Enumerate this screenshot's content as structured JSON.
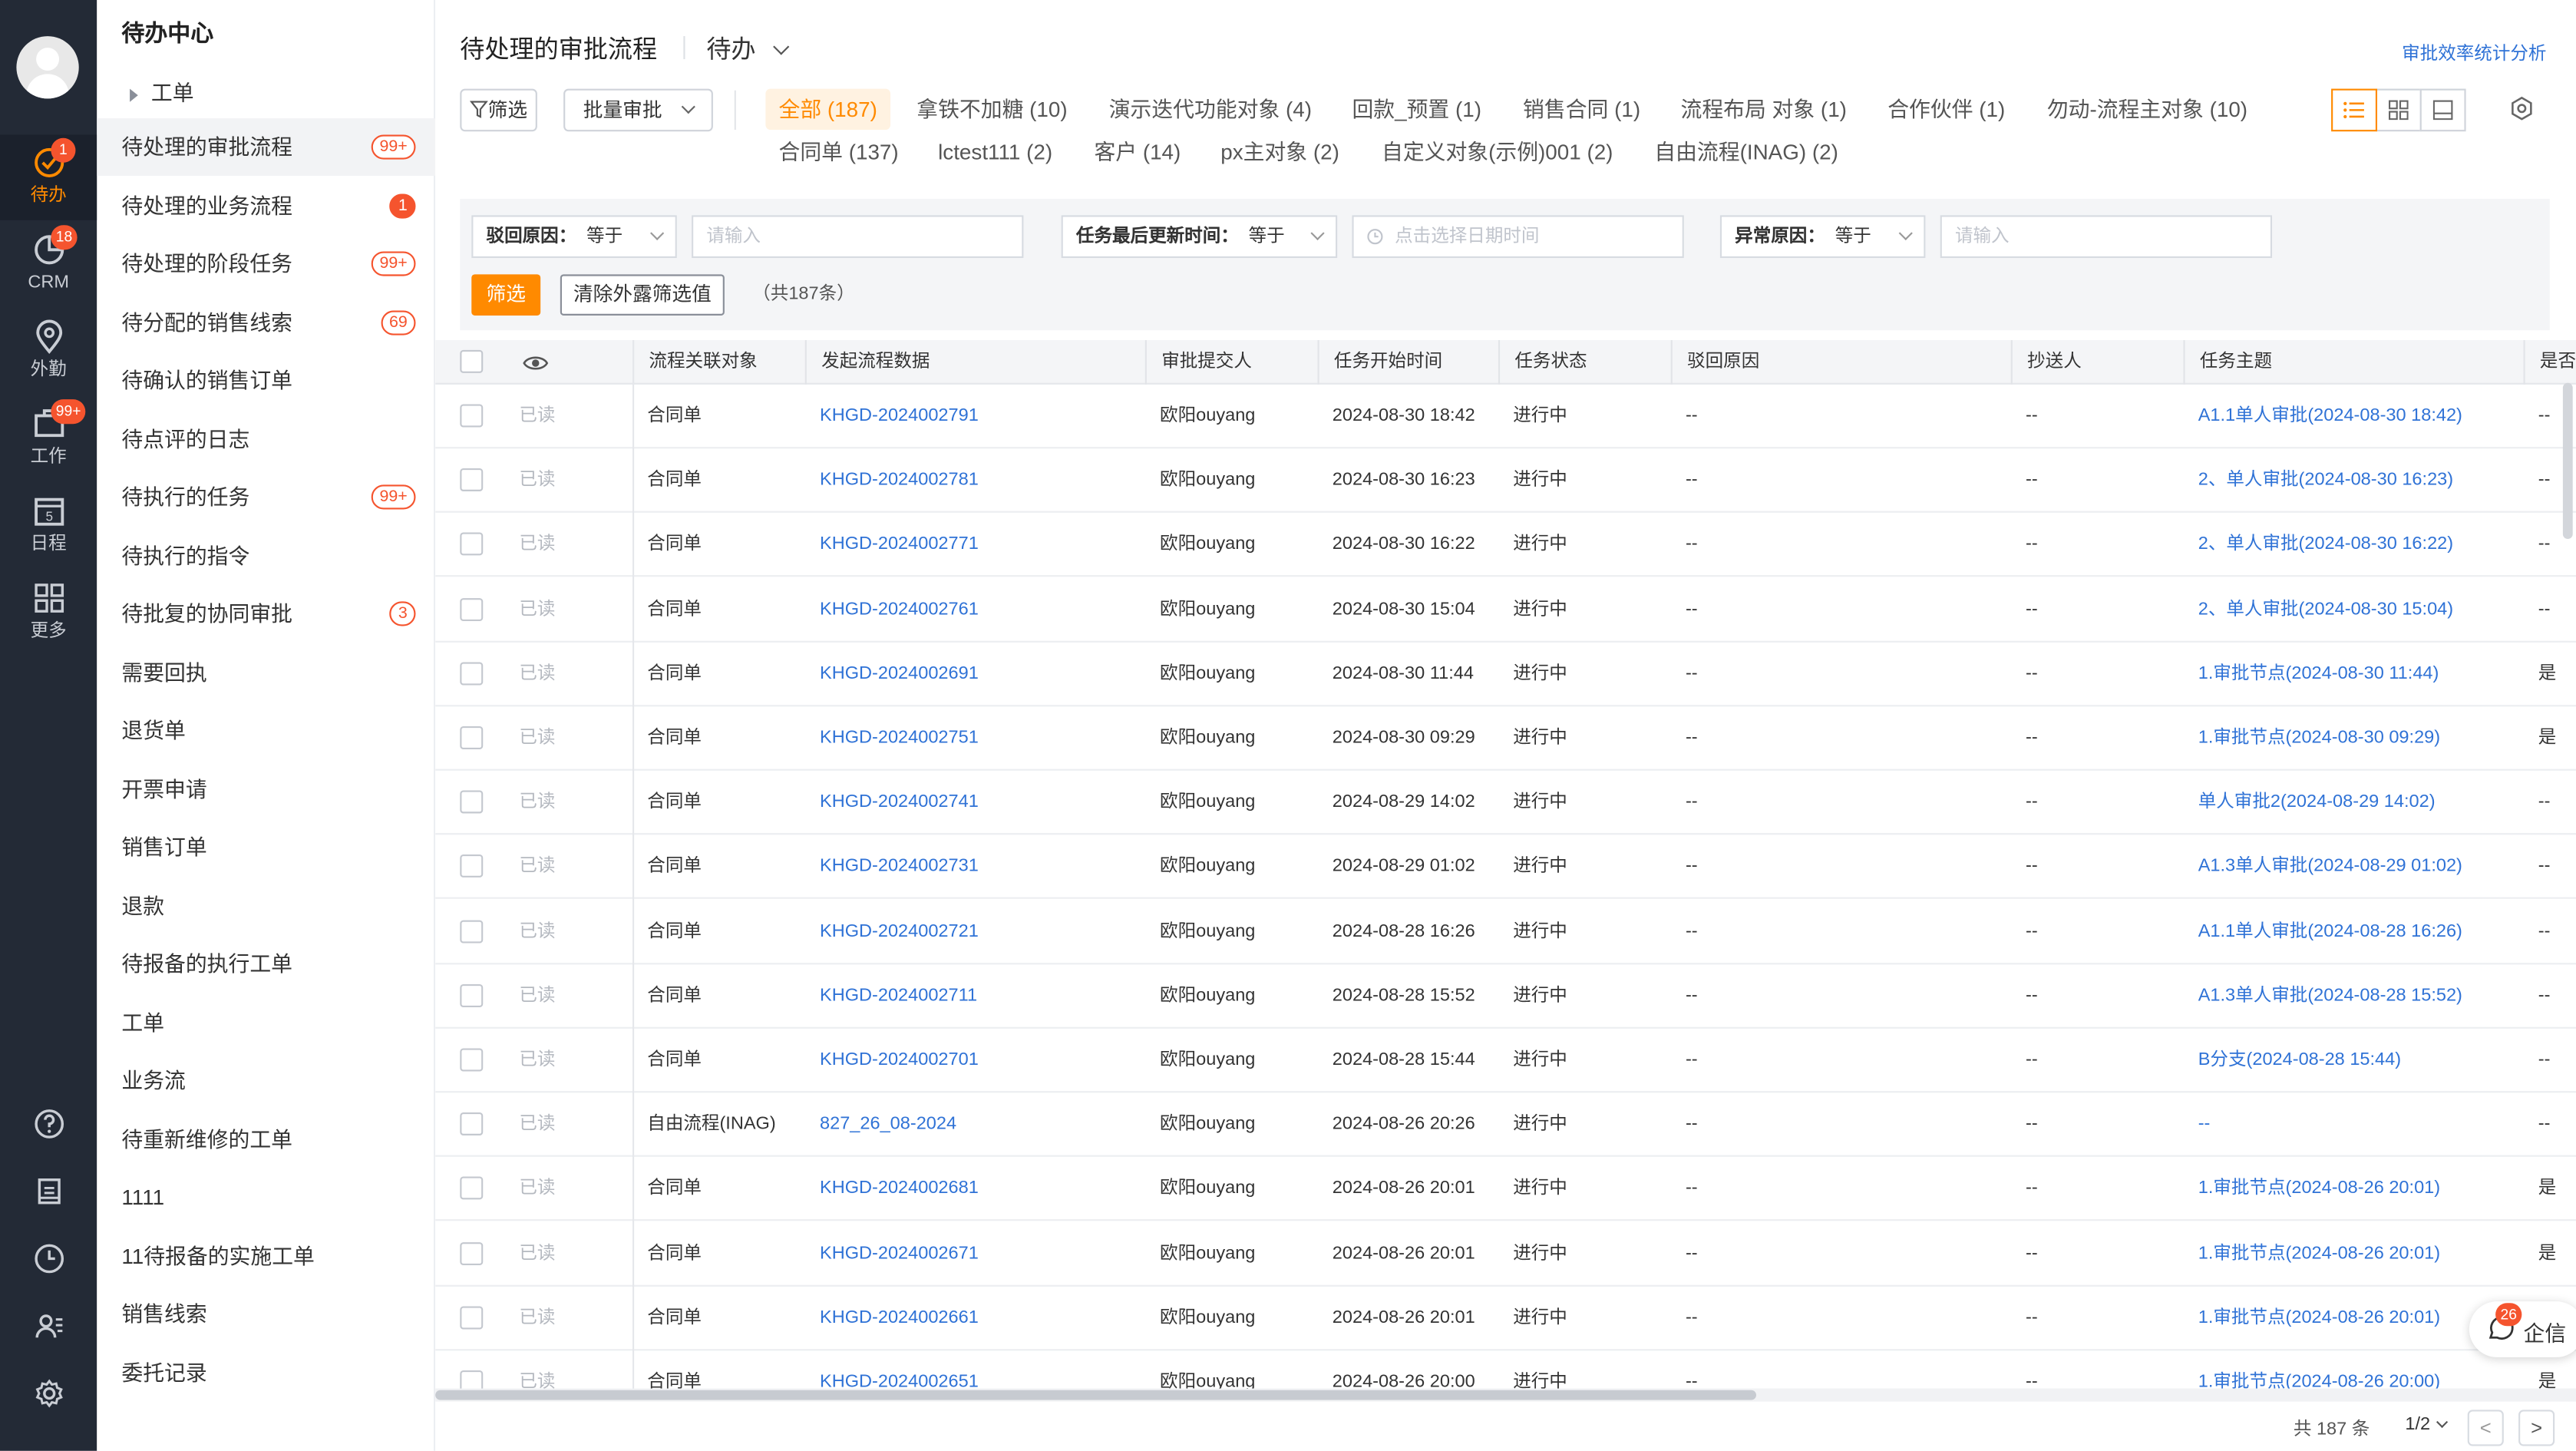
{
  "rail": {
    "items": [
      {
        "label": "待办",
        "badge": "1"
      },
      {
        "label": "CRM",
        "badge": "18"
      },
      {
        "label": "外勤",
        "badge": ""
      },
      {
        "label": "工作",
        "badge": "99+"
      },
      {
        "label": "日程",
        "badge": "",
        "icon_text": "5"
      },
      {
        "label": "更多",
        "badge": ""
      }
    ]
  },
  "sidebar": {
    "title": "待办中心",
    "group": "工单",
    "items": [
      {
        "label": "待处理的审批流程",
        "badge": "99+"
      },
      {
        "label": "待处理的业务流程",
        "badge": "1"
      },
      {
        "label": "待处理的阶段任务",
        "badge": "99+"
      },
      {
        "label": "待分配的销售线索",
        "badge": "69"
      },
      {
        "label": "待确认的销售订单",
        "badge": ""
      },
      {
        "label": "待点评的日志",
        "badge": ""
      },
      {
        "label": "待执行的任务",
        "badge": "99+"
      },
      {
        "label": "待执行的指令",
        "badge": ""
      },
      {
        "label": "待批复的协同审批",
        "badge": "3"
      },
      {
        "label": "需要回执",
        "badge": ""
      },
      {
        "label": "退货单",
        "badge": ""
      },
      {
        "label": "开票申请",
        "badge": ""
      },
      {
        "label": "销售订单",
        "badge": ""
      },
      {
        "label": "退款",
        "badge": ""
      },
      {
        "label": "待报备的执行工单",
        "badge": ""
      },
      {
        "label": "工单",
        "badge": ""
      },
      {
        "label": "业务流",
        "badge": ""
      },
      {
        "label": "待重新维修的工单",
        "badge": ""
      },
      {
        "label": "1111",
        "badge": ""
      },
      {
        "label": "11待报备的实施工单",
        "badge": ""
      },
      {
        "label": "销售线索",
        "badge": ""
      },
      {
        "label": "委托记录",
        "badge": ""
      }
    ]
  },
  "header": {
    "title": "待处理的审批流程",
    "state": "待办",
    "stats_link": "审批效率统计分析"
  },
  "toolbar": {
    "filter_label": "筛选",
    "batch_label": "批量审批",
    "chips_row1": [
      "全部 (187)",
      "拿铁不加糖 (10)",
      "演示迭代功能对象 (4)",
      "回款_预置 (1)",
      "销售合同 (1)",
      "流程布局 对象 (1)",
      "合作伙伴 (1)",
      "勿动-流程主对象 (10)"
    ],
    "chips_row2": [
      "合同单 (137)",
      "lctest111 (2)",
      "客户 (14)",
      "px主对象 (2)",
      "自定义对象(示例)001 (2)",
      "自由流程(INAG) (2)"
    ]
  },
  "filters": {
    "f1_label": "驳回原因：",
    "f1_op": "等于",
    "f1_placeholder": "请输入",
    "f2_label": "任务最后更新时间：",
    "f2_op": "等于",
    "f2_placeholder": "点击选择日期时间",
    "f3_label": "异常原因：",
    "f3_op": "等于",
    "f3_placeholder": "请输入",
    "apply_label": "筛选",
    "clear_label": "清除外露筛选值",
    "count_text": "（共187条）"
  },
  "table": {
    "columns": [
      "流程关联对象",
      "发起流程数据",
      "审批提交人",
      "任务开始时间",
      "任务状态",
      "驳回原因",
      "抄送人",
      "任务主题",
      "是否"
    ],
    "rows": [
      {
        "read": "已读",
        "object": "合同单",
        "data": "KHGD-2024002791",
        "submitter": "欧阳ouyang",
        "start": "2024-08-30 18:42",
        "status": "进行中",
        "reject": "--",
        "cc": "--",
        "subject": "A1.1单人审批(2024-08-30 18:42)",
        "extra": "--"
      },
      {
        "read": "已读",
        "object": "合同单",
        "data": "KHGD-2024002781",
        "submitter": "欧阳ouyang",
        "start": "2024-08-30 16:23",
        "status": "进行中",
        "reject": "--",
        "cc": "--",
        "subject": "2、单人审批(2024-08-30 16:23)",
        "extra": "--"
      },
      {
        "read": "已读",
        "object": "合同单",
        "data": "KHGD-2024002771",
        "submitter": "欧阳ouyang",
        "start": "2024-08-30 16:22",
        "status": "进行中",
        "reject": "--",
        "cc": "--",
        "subject": "2、单人审批(2024-08-30 16:22)",
        "extra": "--"
      },
      {
        "read": "已读",
        "object": "合同单",
        "data": "KHGD-2024002761",
        "submitter": "欧阳ouyang",
        "start": "2024-08-30 15:04",
        "status": "进行中",
        "reject": "--",
        "cc": "--",
        "subject": "2、单人审批(2024-08-30 15:04)",
        "extra": "--"
      },
      {
        "read": "已读",
        "object": "合同单",
        "data": "KHGD-2024002691",
        "submitter": "欧阳ouyang",
        "start": "2024-08-30 11:44",
        "status": "进行中",
        "reject": "--",
        "cc": "--",
        "subject": "1.审批节点(2024-08-30 11:44)",
        "extra": "是"
      },
      {
        "read": "已读",
        "object": "合同单",
        "data": "KHGD-2024002751",
        "submitter": "欧阳ouyang",
        "start": "2024-08-30 09:29",
        "status": "进行中",
        "reject": "--",
        "cc": "--",
        "subject": "1.审批节点(2024-08-30 09:29)",
        "extra": "是"
      },
      {
        "read": "已读",
        "object": "合同单",
        "data": "KHGD-2024002741",
        "submitter": "欧阳ouyang",
        "start": "2024-08-29 14:02",
        "status": "进行中",
        "reject": "--",
        "cc": "--",
        "subject": "单人审批2(2024-08-29 14:02)",
        "extra": "--"
      },
      {
        "read": "已读",
        "object": "合同单",
        "data": "KHGD-2024002731",
        "submitter": "欧阳ouyang",
        "start": "2024-08-29 01:02",
        "status": "进行中",
        "reject": "--",
        "cc": "--",
        "subject": "A1.3单人审批(2024-08-29 01:02)",
        "extra": "--"
      },
      {
        "read": "已读",
        "object": "合同单",
        "data": "KHGD-2024002721",
        "submitter": "欧阳ouyang",
        "start": "2024-08-28 16:26",
        "status": "进行中",
        "reject": "--",
        "cc": "--",
        "subject": "A1.1单人审批(2024-08-28 16:26)",
        "extra": "--"
      },
      {
        "read": "已读",
        "object": "合同单",
        "data": "KHGD-2024002711",
        "submitter": "欧阳ouyang",
        "start": "2024-08-28 15:52",
        "status": "进行中",
        "reject": "--",
        "cc": "--",
        "subject": "A1.3单人审批(2024-08-28 15:52)",
        "extra": "--"
      },
      {
        "read": "已读",
        "object": "合同单",
        "data": "KHGD-2024002701",
        "submitter": "欧阳ouyang",
        "start": "2024-08-28 15:44",
        "status": "进行中",
        "reject": "--",
        "cc": "--",
        "subject": "B分支(2024-08-28 15:44)",
        "extra": "--"
      },
      {
        "read": "已读",
        "object": "自由流程(INAG)",
        "data": "827_26_08-2024",
        "submitter": "欧阳ouyang",
        "start": "2024-08-26 20:26",
        "status": "进行中",
        "reject": "--",
        "cc": "--",
        "subject": "--",
        "extra": "--"
      },
      {
        "read": "已读",
        "object": "合同单",
        "data": "KHGD-2024002681",
        "submitter": "欧阳ouyang",
        "start": "2024-08-26 20:01",
        "status": "进行中",
        "reject": "--",
        "cc": "--",
        "subject": "1.审批节点(2024-08-26 20:01)",
        "extra": "是"
      },
      {
        "read": "已读",
        "object": "合同单",
        "data": "KHGD-2024002671",
        "submitter": "欧阳ouyang",
        "start": "2024-08-26 20:01",
        "status": "进行中",
        "reject": "--",
        "cc": "--",
        "subject": "1.审批节点(2024-08-26 20:01)",
        "extra": "是"
      },
      {
        "read": "已读",
        "object": "合同单",
        "data": "KHGD-2024002661",
        "submitter": "欧阳ouyang",
        "start": "2024-08-26 20:01",
        "status": "进行中",
        "reject": "--",
        "cc": "--",
        "subject": "1.审批节点(2024-08-26 20:01)",
        "extra": "是"
      },
      {
        "read": "已读",
        "object": "合同单",
        "data": "KHGD-2024002651",
        "submitter": "欧阳ouyang",
        "start": "2024-08-26 20:00",
        "status": "进行中",
        "reject": "--",
        "cc": "--",
        "subject": "1.审批节点(2024-08-26 20:00)",
        "extra": "是"
      }
    ]
  },
  "pagination": {
    "total": "共 187 条",
    "page": "1/2",
    "prev": "<",
    "next": ">"
  },
  "qixin": {
    "label": "企信",
    "badge": "26"
  },
  "colors": {
    "accent": "#ff8a00",
    "badge": "#f5542e",
    "link": "#2f72d6",
    "rail": "#232a36"
  }
}
